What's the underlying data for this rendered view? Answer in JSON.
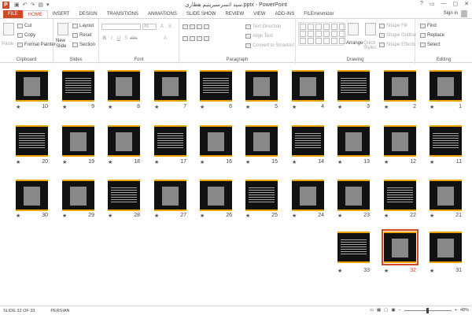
{
  "window": {
    "title": "سيد اتسرسيريتيم هطارى.pptx - PowerPoint",
    "app_icon": "P",
    "qat": [
      "save-icon",
      "undo-icon",
      "redo-icon",
      "slideshow-icon",
      "customize-icon"
    ],
    "buttons": [
      "?",
      "▭",
      "—",
      "▢",
      "✕"
    ]
  },
  "tabs": [
    "FILE",
    "HOME",
    "INSERT",
    "DESIGN",
    "TRANSITIONS",
    "ANIMATIONS",
    "SLIDE SHOW",
    "REVIEW",
    "VIEW",
    "ADD-INS",
    "FILEminimizer"
  ],
  "active_tab": "HOME",
  "signin": "Sign in",
  "ribbon": {
    "clipboard": {
      "label": "Clipboard",
      "paste": "Paste",
      "cut": "Cut",
      "copy": "Copy",
      "format_painter": "Format Painter"
    },
    "slides": {
      "label": "Slides",
      "new_slide": "New\nSlide",
      "layout": "Layout",
      "reset": "Reset",
      "section": "Section"
    },
    "font": {
      "label": "Font",
      "size": "A5"
    },
    "paragraph": {
      "label": "Paragraph",
      "text_direction": "Text Direction",
      "align_text": "Align Text",
      "convert": "Convert to SmartArt"
    },
    "drawing": {
      "label": "Drawing",
      "arrange": "Arrange",
      "quick_styles": "Quick Styles",
      "shape_fill": "Shape Fill",
      "shape_outline": "Shape Outline",
      "shape_effects": "Shape Effects"
    },
    "editing": {
      "label": "Editing",
      "find": "Find",
      "replace": "Replace",
      "select": "Select"
    }
  },
  "slides": [
    {
      "row": 0,
      "numbers": [
        10,
        9,
        8,
        7,
        6,
        5,
        4,
        3,
        2,
        1
      ]
    },
    {
      "row": 1,
      "numbers": [
        20,
        19,
        18,
        17,
        16,
        15,
        14,
        13,
        12,
        11
      ]
    },
    {
      "row": 2,
      "numbers": [
        30,
        29,
        28,
        27,
        26,
        25,
        24,
        23,
        22,
        21
      ]
    },
    {
      "row": 3,
      "numbers": [
        33,
        32,
        31
      ]
    }
  ],
  "selected_slide": 32,
  "status": {
    "slide_info": "SLIDE 32 OF 33",
    "language": "PERSIAN",
    "zoom": "48%"
  }
}
